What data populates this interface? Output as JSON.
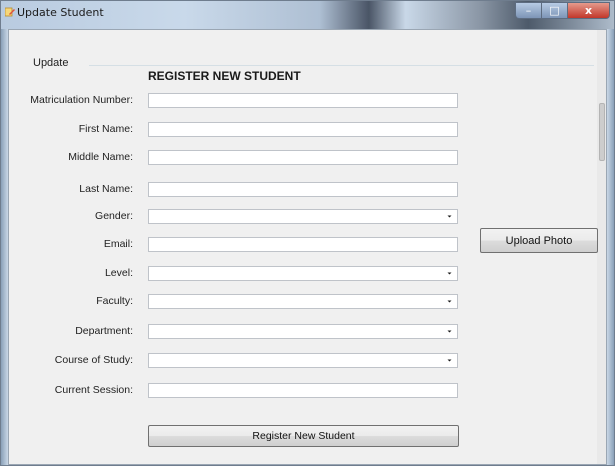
{
  "window": {
    "title": "Update Student",
    "minimize_glyph": "–",
    "maximize_glyph": "□",
    "close_glyph": "x",
    "app_icon": "pencil-form-icon"
  },
  "group": {
    "label": "Update"
  },
  "form": {
    "title": "REGISTER NEW STUDENT",
    "fields": [
      {
        "label": "Matriculation Number:",
        "type": "text",
        "value": ""
      },
      {
        "label": "First Name:",
        "type": "text",
        "value": ""
      },
      {
        "label": "Middle Name:",
        "type": "text",
        "value": ""
      },
      {
        "label": "Last Name:",
        "type": "text",
        "value": ""
      },
      {
        "label": "Gender:",
        "type": "select",
        "value": ""
      },
      {
        "label": "Email:",
        "type": "text",
        "value": ""
      },
      {
        "label": "Level:",
        "type": "select",
        "value": ""
      },
      {
        "label": "Faculty:",
        "type": "select",
        "value": ""
      },
      {
        "label": "Department:",
        "type": "select",
        "value": ""
      },
      {
        "label": "Course of Study:",
        "type": "select",
        "value": ""
      },
      {
        "label": "Current Session:",
        "type": "text",
        "value": ""
      }
    ],
    "upload_label": "Upload Photo",
    "register_label": "Register New Student"
  },
  "colors": {
    "client_bg": "#f0f0f0",
    "input_border": "#bfc3c9",
    "close_red": "#c2372a"
  }
}
